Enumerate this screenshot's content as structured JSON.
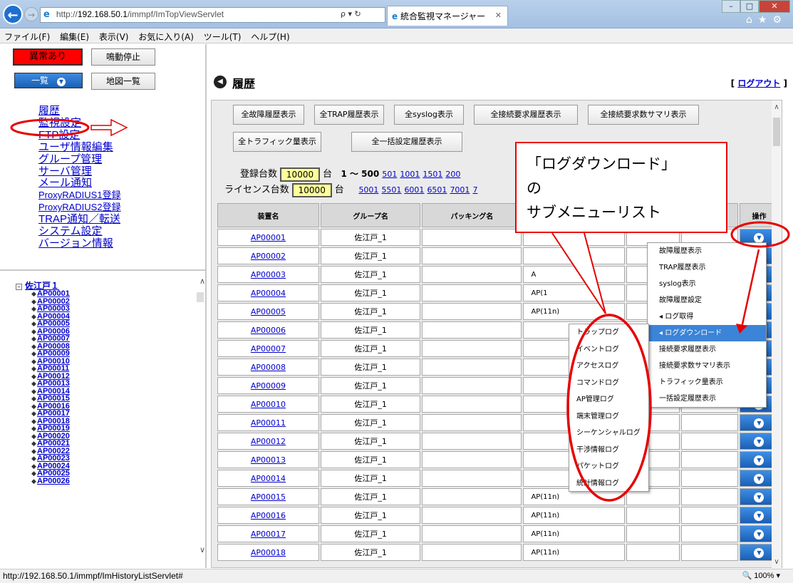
{
  "browser": {
    "url_gray": "http://",
    "url_host": "192.168.50.1",
    "url_path": "/immpf/ImTopViewServlet",
    "addr_ctrls": "ρ ▾ ↻",
    "tab_title": "統合監視マネージャー",
    "tab_close": "✕",
    "win_min": "–",
    "win_max": "□",
    "win_close": "✕",
    "tools": "⌂★⚙"
  },
  "menubar": [
    "ファイル(F)",
    "編集(E)",
    "表示(V)",
    "お気に入り(A)",
    "ツール(T)",
    "ヘルプ(H)"
  ],
  "left": {
    "alarm_label": "異常あり",
    "mute_label": "鳴動停止",
    "list_label": "一覧",
    "map_label": "地図一覧",
    "nav": [
      "履歴",
      "監視設定",
      "FTP設定",
      "ユーザ情報編集",
      "グループ管理",
      "サーバ管理",
      "メール通知",
      "ProxyRADIUS1登録",
      "ProxyRADIUS2登録",
      "TRAP通知／転送",
      "システム設定",
      "バージョン情報"
    ],
    "tree_root": "佐江戸１",
    "tree_items": [
      "AP00001",
      "AP00002",
      "AP00003",
      "AP00004",
      "AP00005",
      "AP00006",
      "AP00007",
      "AP00008",
      "AP00009",
      "AP00010",
      "AP00011",
      "AP00012",
      "AP00013",
      "AP00014",
      "AP00015",
      "AP00016",
      "AP00017",
      "AP00018",
      "AP00019",
      "AP00020",
      "AP00021",
      "AP00022",
      "AP00023",
      "AP00024",
      "AP00025",
      "AP00026"
    ]
  },
  "main": {
    "title": "履歴",
    "logout_pre": "[ ",
    "logout": "ログアウト",
    "logout_post": " ]",
    "buttons_row1": [
      "全故障履歴表示",
      "全TRAP履歴表示",
      "全syslog表示",
      "全接続要求履歴表示",
      "全接続要求数サマリ表示"
    ],
    "buttons_row2": [
      "全トラフィック量表示",
      "全一括設定履歴表示"
    ],
    "registered_label": "登録台数",
    "registered_value": "10000",
    "license_label": "ライセンス台数",
    "license_value": "10000",
    "unit": "台",
    "range_current": "1 ～ 500",
    "pages_row1": [
      "501",
      "1001",
      "1501",
      "200"
    ],
    "pages_row2": [
      "5001",
      "5501",
      "6001",
      "6501",
      "7001",
      "7"
    ],
    "headers": [
      "装置名",
      "グループ名",
      "パッキング名",
      "",
      "",
      "",
      "操作"
    ],
    "rows": [
      {
        "name": "AP00001",
        "group": "佐江戸_1",
        "model": ""
      },
      {
        "name": "AP00002",
        "group": "佐江戸_1",
        "model": ""
      },
      {
        "name": "AP00003",
        "group": "佐江戸_1",
        "model": "A"
      },
      {
        "name": "AP00004",
        "group": "佐江戸_1",
        "model": "AP(1"
      },
      {
        "name": "AP00005",
        "group": "佐江戸_1",
        "model": "AP(11n)"
      },
      {
        "name": "AP00006",
        "group": "佐江戸_1",
        "model": ""
      },
      {
        "name": "AP00007",
        "group": "佐江戸_1",
        "model": ""
      },
      {
        "name": "AP00008",
        "group": "佐江戸_1",
        "model": ""
      },
      {
        "name": "AP00009",
        "group": "佐江戸_1",
        "model": ""
      },
      {
        "name": "AP00010",
        "group": "佐江戸_1",
        "model": ""
      },
      {
        "name": "AP00011",
        "group": "佐江戸_1",
        "model": ""
      },
      {
        "name": "AP00012",
        "group": "佐江戸_1",
        "model": ""
      },
      {
        "name": "AP00013",
        "group": "佐江戸_1",
        "model": ""
      },
      {
        "name": "AP00014",
        "group": "佐江戸_1",
        "model": ""
      },
      {
        "name": "AP00015",
        "group": "佐江戸_1",
        "model": "AP(11n)"
      },
      {
        "name": "AP00016",
        "group": "佐江戸_1",
        "model": "AP(11n)"
      },
      {
        "name": "AP00017",
        "group": "佐江戸_1",
        "model": "AP(11n)"
      },
      {
        "name": "AP00018",
        "group": "佐江戸_1",
        "model": "AP(11n)"
      }
    ]
  },
  "submenu": [
    "故障履歴表示",
    "TRAP履歴表示",
    "syslog表示",
    "故障履歴設定",
    "◂ ログ取得",
    "◂ ログダウンロード",
    "接続要求履歴表示",
    "接続要求数サマリ表示",
    "トラフィック量表示",
    "一括設定履歴表示"
  ],
  "sublist": [
    "トラップログ",
    "イベントログ",
    "アクセスログ",
    "コマンドログ",
    "AP管理ログ",
    "端末管理ログ",
    "シーケンシャルログ",
    "干渉情報ログ",
    "パケットログ",
    "統計情報ログ"
  ],
  "callout": {
    "line1": "「ログダウンロード」",
    "line2": "の",
    "line3": "サブメニューリスト"
  },
  "status": {
    "url": "http://192.168.50.1/immpf/ImHistoryListServlet#",
    "zoom": "🔍 100%  ▾"
  },
  "colors": {
    "annotation": "#e60000",
    "highlight": "#3b84d8"
  }
}
